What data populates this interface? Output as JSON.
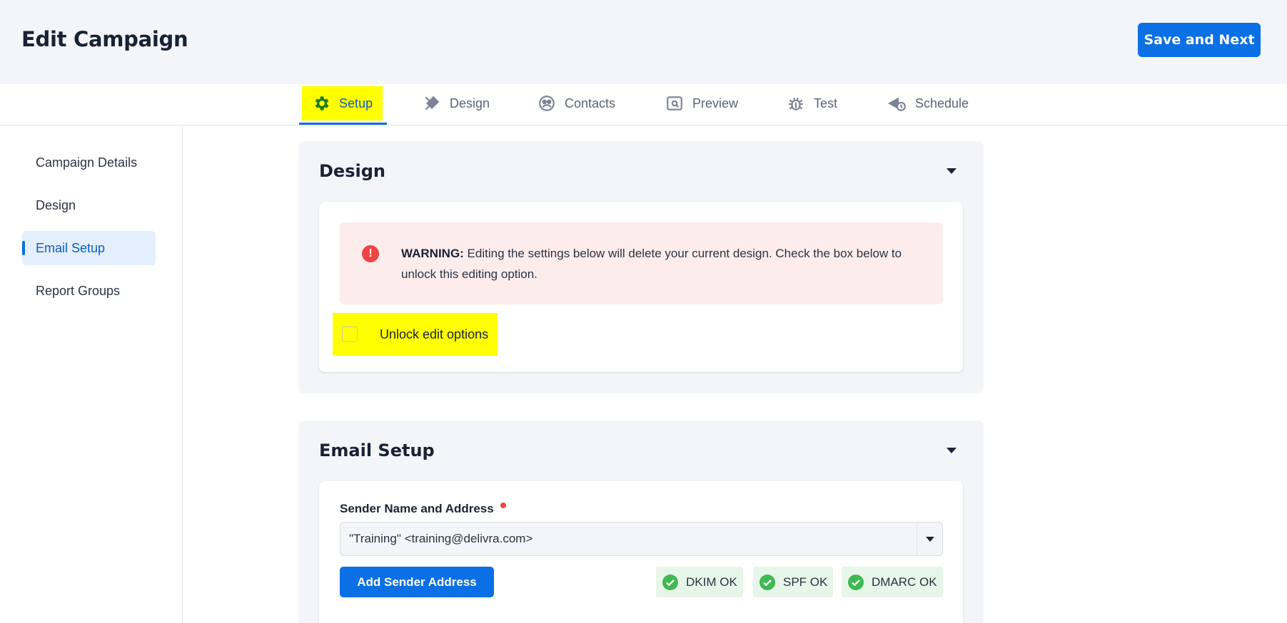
{
  "header": {
    "title": "Edit Campaign",
    "save_label": "Save and Next"
  },
  "tabs": [
    {
      "label": "Setup",
      "icon": "gear-icon",
      "active": true
    },
    {
      "label": "Design",
      "icon": "design-tools-icon"
    },
    {
      "label": "Contacts",
      "icon": "contacts-icon"
    },
    {
      "label": "Preview",
      "icon": "preview-icon"
    },
    {
      "label": "Test",
      "icon": "bug-icon"
    },
    {
      "label": "Schedule",
      "icon": "schedule-icon"
    }
  ],
  "sidebar": {
    "items": [
      {
        "label": "Campaign Details"
      },
      {
        "label": "Design"
      },
      {
        "label": "Email Setup",
        "active": true
      },
      {
        "label": "Report Groups"
      }
    ]
  },
  "design_section": {
    "title": "Design",
    "warning_strong": "WARNING:",
    "warning_text": " Editing the settings below will delete your current design. Check the box below to unlock this editing option.",
    "unlock_label": "Unlock edit options",
    "unlock_checked": false
  },
  "email_section": {
    "title": "Email Setup",
    "sender_label": "Sender Name and Address",
    "sender_value": "\"Training\" <training@delivra.com>",
    "add_sender_label": "Add Sender Address",
    "badges": [
      {
        "label": "DKIM OK"
      },
      {
        "label": "SPF OK"
      },
      {
        "label": "DMARC OK"
      }
    ]
  },
  "colors": {
    "accent": "#0b6fe5",
    "highlight": "#ffff00",
    "ok_green": "#3fb950",
    "warning_red": "#ef4444"
  }
}
